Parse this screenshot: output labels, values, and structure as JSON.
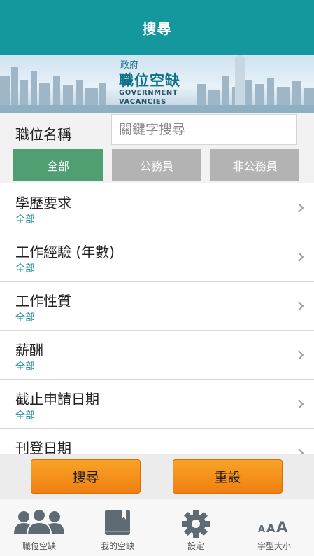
{
  "header": {
    "title": "搜尋"
  },
  "banner": {
    "logo_line1": "政府",
    "logo_line2": "職位空缺",
    "logo_line3": "GOVERNMENT",
    "logo_line4": "VACANCIES"
  },
  "search": {
    "label": "職位名稱",
    "placeholder": "關鍵字搜尋",
    "value": ""
  },
  "segments": [
    {
      "label": "全部",
      "selected": true
    },
    {
      "label": "公務員",
      "selected": false
    },
    {
      "label": "非公務員",
      "selected": false
    }
  ],
  "filters": [
    {
      "title": "學歷要求",
      "value": "全部"
    },
    {
      "title": "工作經驗 (年數)",
      "value": "全部"
    },
    {
      "title": "工作性質",
      "value": "全部"
    },
    {
      "title": "薪酬",
      "value": "全部"
    },
    {
      "title": "截止申請日期",
      "value": "全部"
    },
    {
      "title": "刊登日期",
      "value": ""
    }
  ],
  "actions": {
    "search_label": "搜尋",
    "reset_label": "重設"
  },
  "tabbar": [
    {
      "label": "職位空缺",
      "icon": "people-icon"
    },
    {
      "label": "我的空缺",
      "icon": "bookmark-book-icon"
    },
    {
      "label": "設定",
      "icon": "gear-icon"
    },
    {
      "label": "字型大小",
      "icon": "font-size-icon"
    }
  ],
  "colors": {
    "header": "#14979d",
    "segment_selected": "#4f9f73",
    "segment_unselected": "#b3b3b3",
    "button": "#f29018",
    "filter_value": "#1a8c96"
  }
}
